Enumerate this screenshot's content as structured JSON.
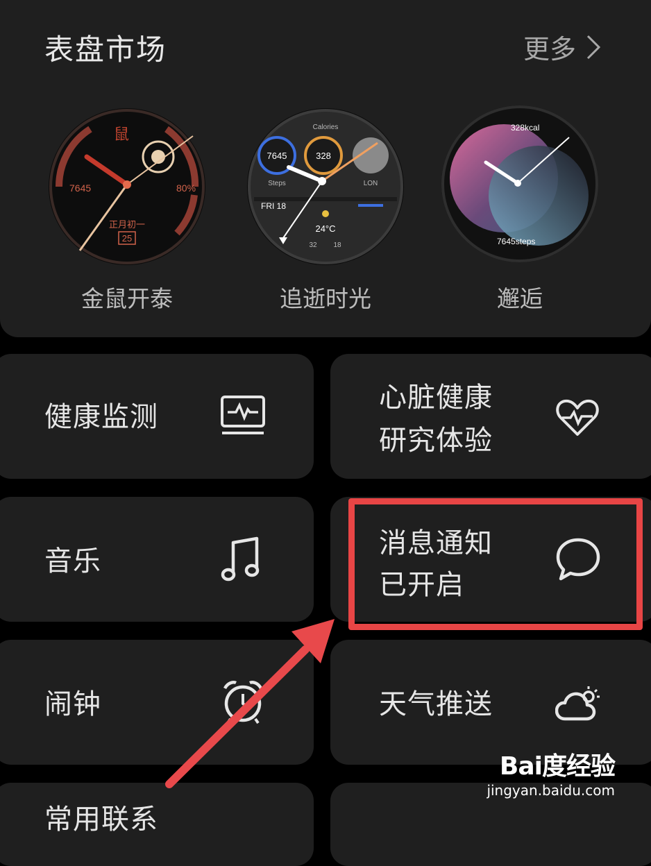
{
  "face_market": {
    "title": "表盘市场",
    "more": "更多",
    "faces": [
      {
        "name": "金鼠开泰",
        "steps": "7645",
        "battery": "80%",
        "lunar": "正月初一",
        "day": "25"
      },
      {
        "name": "追逝时光",
        "calories_label": "Calories",
        "steps": "7645",
        "calories": "328",
        "steps_label": "Steps",
        "city": "LON",
        "date": "FRI 18",
        "temp": "24°C",
        "low": "32",
        "high": "18"
      },
      {
        "name": "邂逅",
        "kcal": "328kcal",
        "steps": "7645steps"
      }
    ]
  },
  "tiles": [
    {
      "label": "健康监测",
      "icon": "heart-rate-monitor-icon"
    },
    {
      "label_line1": "心脏健康",
      "label_line2": "研究体验",
      "icon": "heart-pulse-icon"
    },
    {
      "label": "音乐",
      "icon": "music-note-icon"
    },
    {
      "label_line1": "消息通知",
      "label_line2": "已开启",
      "icon": "message-bubble-icon"
    },
    {
      "label": "闹钟",
      "icon": "alarm-clock-icon"
    },
    {
      "label": "天气推送",
      "icon": "weather-cloud-sun-icon"
    },
    {
      "label": "常用联系"
    }
  ],
  "watermark": {
    "logo": "Bai度经验",
    "url": "jingyan.baidu.com"
  },
  "colors": {
    "highlight": "#e84545",
    "arrow": "#e8494b",
    "card": "#1f1f1f"
  }
}
